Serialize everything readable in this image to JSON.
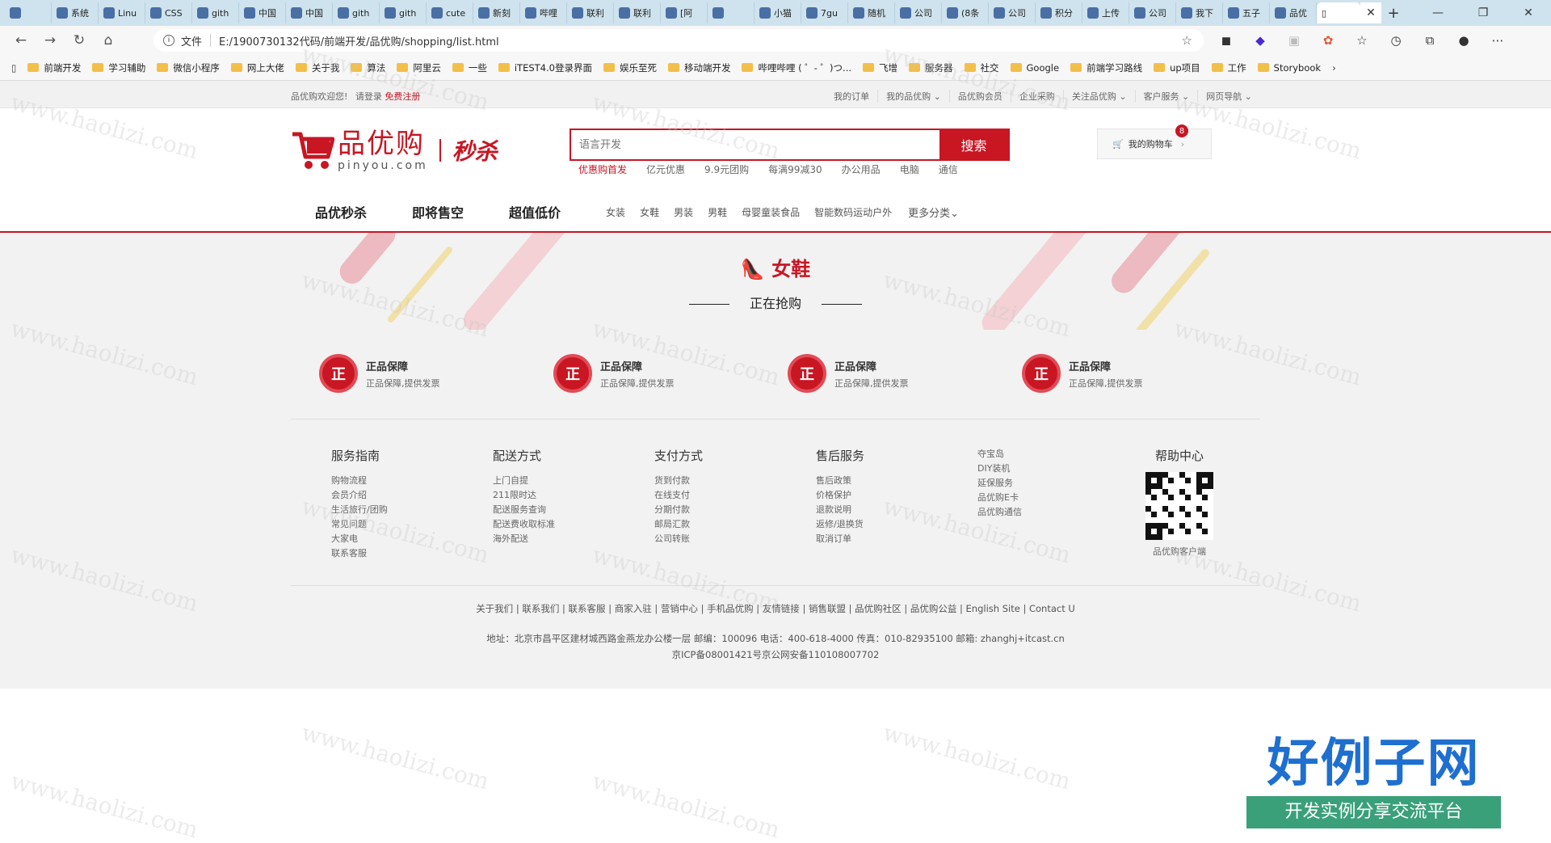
{
  "browser": {
    "tabs": [
      {
        "label": "系统"
      },
      {
        "label": "Linu"
      },
      {
        "label": "CSS"
      },
      {
        "label": "gith"
      },
      {
        "label": "中国"
      },
      {
        "label": "中国"
      },
      {
        "label": "gith"
      },
      {
        "label": "gith"
      },
      {
        "label": "cute"
      },
      {
        "label": "新刻"
      },
      {
        "label": "哔哩"
      },
      {
        "label": "联利"
      },
      {
        "label": "联利"
      },
      {
        "label": "[阿"
      },
      {
        "label": ""
      },
      {
        "label": "小猫"
      },
      {
        "label": "7gu"
      },
      {
        "label": "随机"
      },
      {
        "label": "公司"
      },
      {
        "label": "(8条"
      },
      {
        "label": "公司"
      },
      {
        "label": "积分"
      },
      {
        "label": "上传"
      },
      {
        "label": "公司"
      },
      {
        "label": "我下"
      },
      {
        "label": "五子"
      },
      {
        "label": "品优"
      }
    ],
    "active_tab": {
      "label": "",
      "close": "✕"
    },
    "new_tab": "+",
    "address": {
      "prefix": "文件",
      "url": "E:/1900730132代码/前端开发/品优购/shopping/list.html"
    },
    "bookmarks": [
      {
        "label": "前端开发"
      },
      {
        "label": "学习辅助"
      },
      {
        "label": "微信小程序"
      },
      {
        "label": "网上大佬"
      },
      {
        "label": "关于我"
      },
      {
        "label": "算法"
      },
      {
        "label": "阿里云"
      },
      {
        "label": "一些"
      },
      {
        "label": "iTEST4.0登录界面"
      },
      {
        "label": "娱乐至死"
      },
      {
        "label": "移动端开发"
      },
      {
        "label": "哔哩哔哩 ( ゜- ゜)つ..."
      },
      {
        "label": "飞增"
      },
      {
        "label": "服务器"
      },
      {
        "label": "社交"
      },
      {
        "label": "Google"
      },
      {
        "label": "前端学习路线"
      },
      {
        "label": "up项目"
      },
      {
        "label": "工作"
      },
      {
        "label": "Storybook"
      }
    ]
  },
  "shortcut": {
    "welcome": "品优购欢迎您!",
    "login": "请登录",
    "register": "免费注册",
    "links": [
      "我的订单",
      "我的品优购 ⌄",
      "品优购会员",
      "企业采购",
      "关注品优购 ⌄",
      "客户服务 ⌄",
      "网页导航 ⌄"
    ]
  },
  "header": {
    "logo_cn": "品优购",
    "logo_en": "pinyou.com",
    "logo_seckill": "秒杀",
    "search_placeholder": "语言开发",
    "search_button": "搜索",
    "hotwords": [
      "优惠购首发",
      "亿元优惠",
      "9.9元团购",
      "每满99减30",
      "办公用品",
      "电脑",
      "通信"
    ],
    "cart_label": "我的购物车",
    "cart_count": "8",
    "nav_main": [
      "品优秒杀",
      "即将售空",
      "超值低价"
    ],
    "nav_sub": [
      "女装",
      "女鞋",
      "男装",
      "男鞋",
      "母婴童装食品",
      "智能数码运动户外"
    ],
    "nav_more": "更多分类⌄"
  },
  "banner": {
    "title": "女鞋",
    "subtitle": "正在抢购"
  },
  "footer": {
    "promises": [
      {
        "icon": "正",
        "title": "正品保障",
        "desc": "正品保障,提供发票"
      },
      {
        "icon": "正",
        "title": "正品保障",
        "desc": "正品保障,提供发票"
      },
      {
        "icon": "正",
        "title": "正品保障",
        "desc": "正品保障,提供发票"
      },
      {
        "icon": "正",
        "title": "正品保障",
        "desc": "正品保障,提供发票"
      }
    ],
    "columns": [
      {
        "title": "服务指南",
        "items": [
          "购物流程",
          "会员介绍",
          "生活旅行/团购",
          "常见问题",
          "大家电",
          "联系客服"
        ]
      },
      {
        "title": "配送方式",
        "items": [
          "上门自提",
          "211限时达",
          "配送服务查询",
          "配送费收取标准",
          "海外配送"
        ]
      },
      {
        "title": "支付方式",
        "items": [
          "货到付款",
          "在线支付",
          "分期付款",
          "邮局汇款",
          "公司转账"
        ]
      },
      {
        "title": "售后服务",
        "items": [
          "售后政策",
          "价格保护",
          "退款说明",
          "返修/退换货",
          "取消订单"
        ]
      },
      {
        "title": "",
        "items": [
          "夺宝岛",
          "DIY装机",
          "延保服务",
          "品优购E卡",
          "品优购通信"
        ]
      }
    ],
    "help": {
      "title": "帮助中心",
      "qr_caption": "品优购客户端"
    },
    "links": "关于我们 | 联系我们 | 联系客服 | 商家入驻 | 营销中心 | 手机品优购 | 友情链接 | 销售联盟 | 品优购社区 | 品优购公益 | English Site | Contact U",
    "address": "地址：北京市昌平区建材城西路金燕龙办公楼一层 邮编：100096 电话：400-618-4000 传真：010-82935100 邮箱: zhanghj+itcast.cn",
    "icp": "京ICP备08001421号京公网安备110108007702"
  },
  "overlay": {
    "watermark": "www.haolizi.com",
    "brand_big": "好例子网",
    "brand_small": "开发实例分享交流平台"
  },
  "colors": {
    "brand_red": "#c81623",
    "footer_bg": "#f2f2f2"
  }
}
